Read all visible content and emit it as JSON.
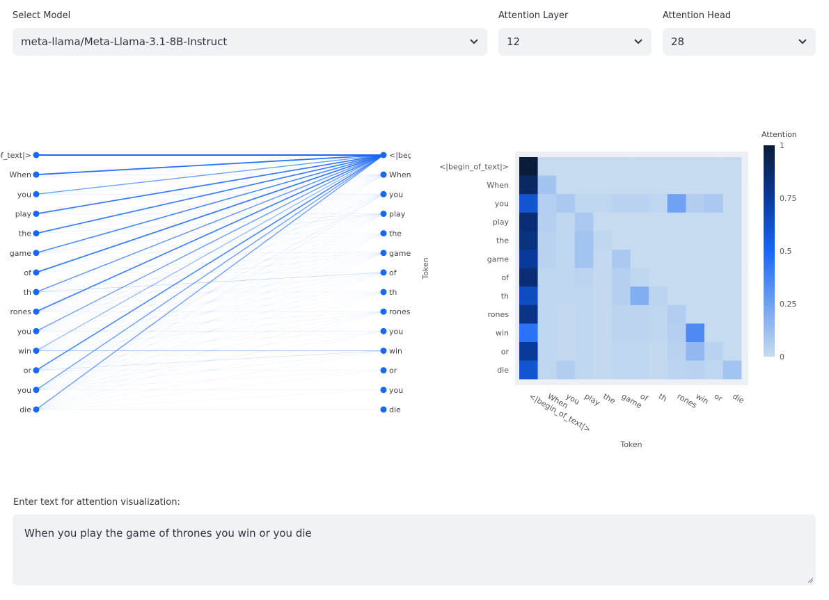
{
  "controls": {
    "model_label": "Select Model",
    "model_value": "meta-llama/Meta-Llama-3.1-8B-Instruct",
    "layer_label": "Attention Layer",
    "layer_value": "12",
    "head_label": "Attention Head",
    "head_value": "28"
  },
  "input": {
    "label": "Enter text for attention visualization:",
    "value": "When you play the game of thrones you win or you die"
  },
  "colors": {
    "accent": "#1967f5",
    "panel": "#f0f2f6",
    "heat_low": "#c6dbef",
    "heat_high": "#08306b"
  },
  "chart_data": [
    {
      "type": "line",
      "subtype": "attention-lines",
      "left_tokens": [
        "<|begin_of_text|>",
        "When",
        "you",
        "play",
        "the",
        "game",
        "of",
        "th",
        "rones",
        "you",
        "win",
        "or",
        "you",
        "die"
      ],
      "right_tokens": [
        "<|begin_of_text|>",
        "When",
        "you",
        "play",
        "the",
        "game",
        "of",
        "th",
        "rones",
        "you",
        "win",
        "or",
        "you",
        "die"
      ],
      "attention": [
        [
          1.0,
          0,
          0,
          0,
          0,
          0,
          0,
          0,
          0,
          0,
          0,
          0,
          0,
          0
        ],
        [
          0.9,
          0.1,
          0,
          0,
          0,
          0,
          0,
          0,
          0,
          0,
          0,
          0,
          0,
          0
        ],
        [
          0.6,
          0.05,
          0.08,
          0,
          0,
          0,
          0,
          0,
          0,
          0,
          0,
          0,
          0,
          0
        ],
        [
          0.85,
          0.05,
          0.02,
          0.08,
          0,
          0,
          0,
          0,
          0,
          0,
          0,
          0,
          0,
          0
        ],
        [
          0.82,
          0.04,
          0.02,
          0.1,
          0.02,
          0,
          0,
          0,
          0,
          0,
          0,
          0,
          0,
          0
        ],
        [
          0.75,
          0.04,
          0.02,
          0.1,
          0.01,
          0.08,
          0,
          0,
          0,
          0,
          0,
          0,
          0,
          0
        ],
        [
          0.85,
          0.02,
          0.02,
          0.03,
          0.01,
          0.05,
          0.02,
          0,
          0,
          0,
          0,
          0,
          0,
          0
        ],
        [
          0.65,
          0.02,
          0.02,
          0.02,
          0.01,
          0.05,
          0.2,
          0.03,
          0,
          0,
          0,
          0,
          0,
          0
        ],
        [
          0.8,
          0.02,
          0.01,
          0.02,
          0.01,
          0.03,
          0.03,
          0.02,
          0.06,
          0,
          0,
          0,
          0,
          0
        ],
        [
          0.6,
          0.05,
          0.08,
          0.02,
          0.01,
          0.03,
          0.02,
          0.02,
          0.03,
          0.08,
          0,
          0,
          0,
          0
        ],
        [
          0.45,
          0.02,
          0.01,
          0.02,
          0.01,
          0.03,
          0.03,
          0.02,
          0.05,
          0.01,
          0.35,
          0,
          0,
          0
        ],
        [
          0.75,
          0.02,
          0.01,
          0.02,
          0.01,
          0.02,
          0.02,
          0.01,
          0.04,
          0.01,
          0.15,
          0.04,
          0,
          0
        ],
        [
          0.6,
          0.03,
          0.1,
          0.02,
          0.01,
          0.02,
          0.02,
          0.01,
          0.03,
          0.05,
          0.05,
          0.02,
          0.04,
          0
        ],
        [
          0.6,
          0.02,
          0.06,
          0.02,
          0.01,
          0.02,
          0.02,
          0.01,
          0.03,
          0.02,
          0.04,
          0.02,
          0.02,
          0.1
        ]
      ]
    },
    {
      "type": "heatmap",
      "title": "",
      "xlabel": "Token",
      "ylabel": "Token",
      "colorbar_title": "Attention",
      "colorbar_ticks": [
        "0",
        "0.25",
        "0.5",
        "0.75",
        "1"
      ],
      "x_tokens": [
        "<|begin_of_text|>",
        "When",
        "you",
        "play",
        "the",
        "game",
        "of",
        "th",
        "rones",
        "win",
        "or",
        "die"
      ],
      "y_tokens": [
        "<|begin_of_text|>",
        "When",
        "you",
        "play",
        "the",
        "game",
        "of",
        "th",
        "rones",
        "win",
        "or",
        "die"
      ],
      "zlim": [
        0,
        1
      ],
      "z": [
        [
          1.0,
          0,
          0,
          0,
          0,
          0,
          0,
          0,
          0,
          0,
          0,
          0
        ],
        [
          0.9,
          0.1,
          0,
          0,
          0,
          0,
          0,
          0,
          0,
          0,
          0,
          0
        ],
        [
          0.6,
          0.05,
          0.08,
          0.02,
          0.02,
          0.04,
          0.04,
          0.02,
          0.25,
          0.06,
          0.08,
          0
        ],
        [
          0.85,
          0.05,
          0.02,
          0.08,
          0,
          0,
          0,
          0,
          0,
          0,
          0,
          0
        ],
        [
          0.82,
          0.04,
          0.02,
          0.1,
          0.02,
          0,
          0,
          0,
          0,
          0,
          0,
          0
        ],
        [
          0.75,
          0.04,
          0.02,
          0.1,
          0.01,
          0.08,
          0,
          0,
          0,
          0,
          0,
          0
        ],
        [
          0.85,
          0.02,
          0.02,
          0.03,
          0.01,
          0.05,
          0.02,
          0,
          0,
          0,
          0,
          0
        ],
        [
          0.65,
          0.02,
          0.02,
          0.02,
          0.01,
          0.05,
          0.2,
          0.03,
          0,
          0,
          0,
          0
        ],
        [
          0.8,
          0.02,
          0.01,
          0.02,
          0.01,
          0.03,
          0.03,
          0.02,
          0.06,
          0,
          0,
          0
        ],
        [
          0.45,
          0.02,
          0.01,
          0.02,
          0.01,
          0.03,
          0.03,
          0.02,
          0.05,
          0.35,
          0,
          0
        ],
        [
          0.75,
          0.02,
          0.01,
          0.02,
          0.01,
          0.02,
          0.02,
          0.01,
          0.04,
          0.15,
          0.04,
          0
        ],
        [
          0.6,
          0.02,
          0.06,
          0.02,
          0.01,
          0.02,
          0.02,
          0.01,
          0.03,
          0.04,
          0.02,
          0.1
        ]
      ]
    }
  ]
}
